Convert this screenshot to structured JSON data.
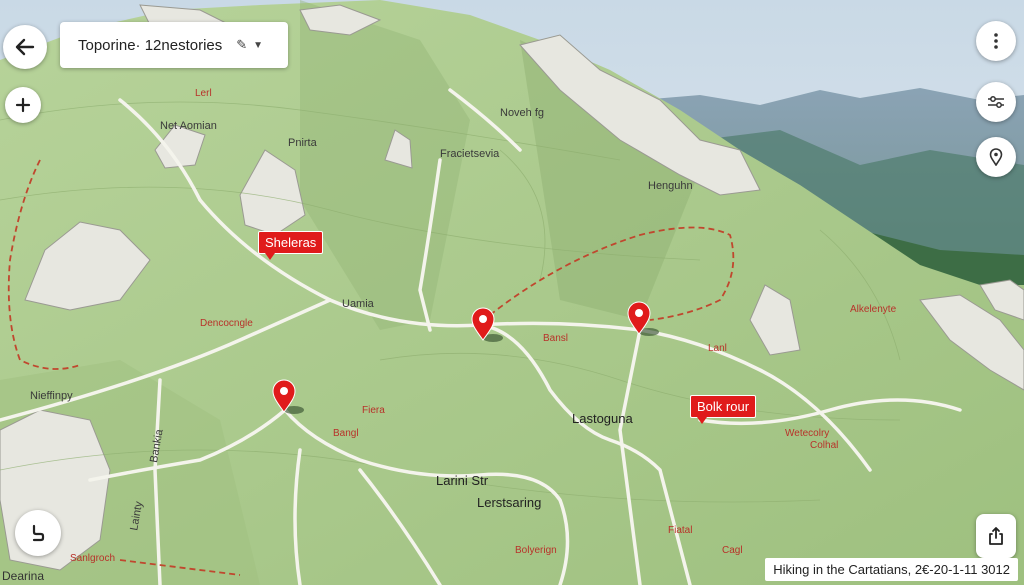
{
  "header": {
    "title": "Toporine· 12nestories",
    "edit_icon": "pencil-icon",
    "dropdown_icon": "chevron-down-icon"
  },
  "controls": {
    "back_icon": "arrow-left-icon",
    "zoom_in_icon": "plus-icon",
    "more_icon": "kebab-menu-icon",
    "filter_icon": "sliders-icon",
    "location_icon": "location-pin-icon",
    "share_icon": "share-icon",
    "route_icon": "route-icon"
  },
  "place_labels": [
    {
      "text": "Net Aomian"
    },
    {
      "text": "Pnirta"
    },
    {
      "text": "Noveh fg"
    },
    {
      "text": "Fracietsevia"
    },
    {
      "text": "Henguhn"
    },
    {
      "text": "Uamia"
    },
    {
      "text": "Lastoguna"
    },
    {
      "text": "Larini Str"
    },
    {
      "text": "Lerstsaring"
    },
    {
      "text": "Nieffinpy"
    },
    {
      "text": "Lainty"
    },
    {
      "text": "Bankia"
    }
  ],
  "red_labels": [
    {
      "text": "Dencocngle"
    },
    {
      "text": "Bansl"
    },
    {
      "text": "Fiera"
    },
    {
      "text": "Bangl"
    },
    {
      "text": "Bolyerign"
    },
    {
      "text": "Sanlgroch"
    },
    {
      "text": "Alkelenyte"
    },
    {
      "text": "Wetecolry"
    },
    {
      "text": "Colhal"
    },
    {
      "text": "Fiatal"
    },
    {
      "text": "Cagl"
    },
    {
      "text": "Lanl"
    },
    {
      "text": "Lerl"
    }
  ],
  "tags": {
    "shelters": "Sheleras",
    "bolk": "Bolk rour"
  },
  "caption": "Hiking in the Cartatians, 2€-20-1-11 3012",
  "corner_text": "Dearina",
  "colors": {
    "marker": "#e01b1b",
    "terrain": "#a9c98a",
    "trail_dashed": "#c0472e",
    "path": "#f2f2ea"
  }
}
